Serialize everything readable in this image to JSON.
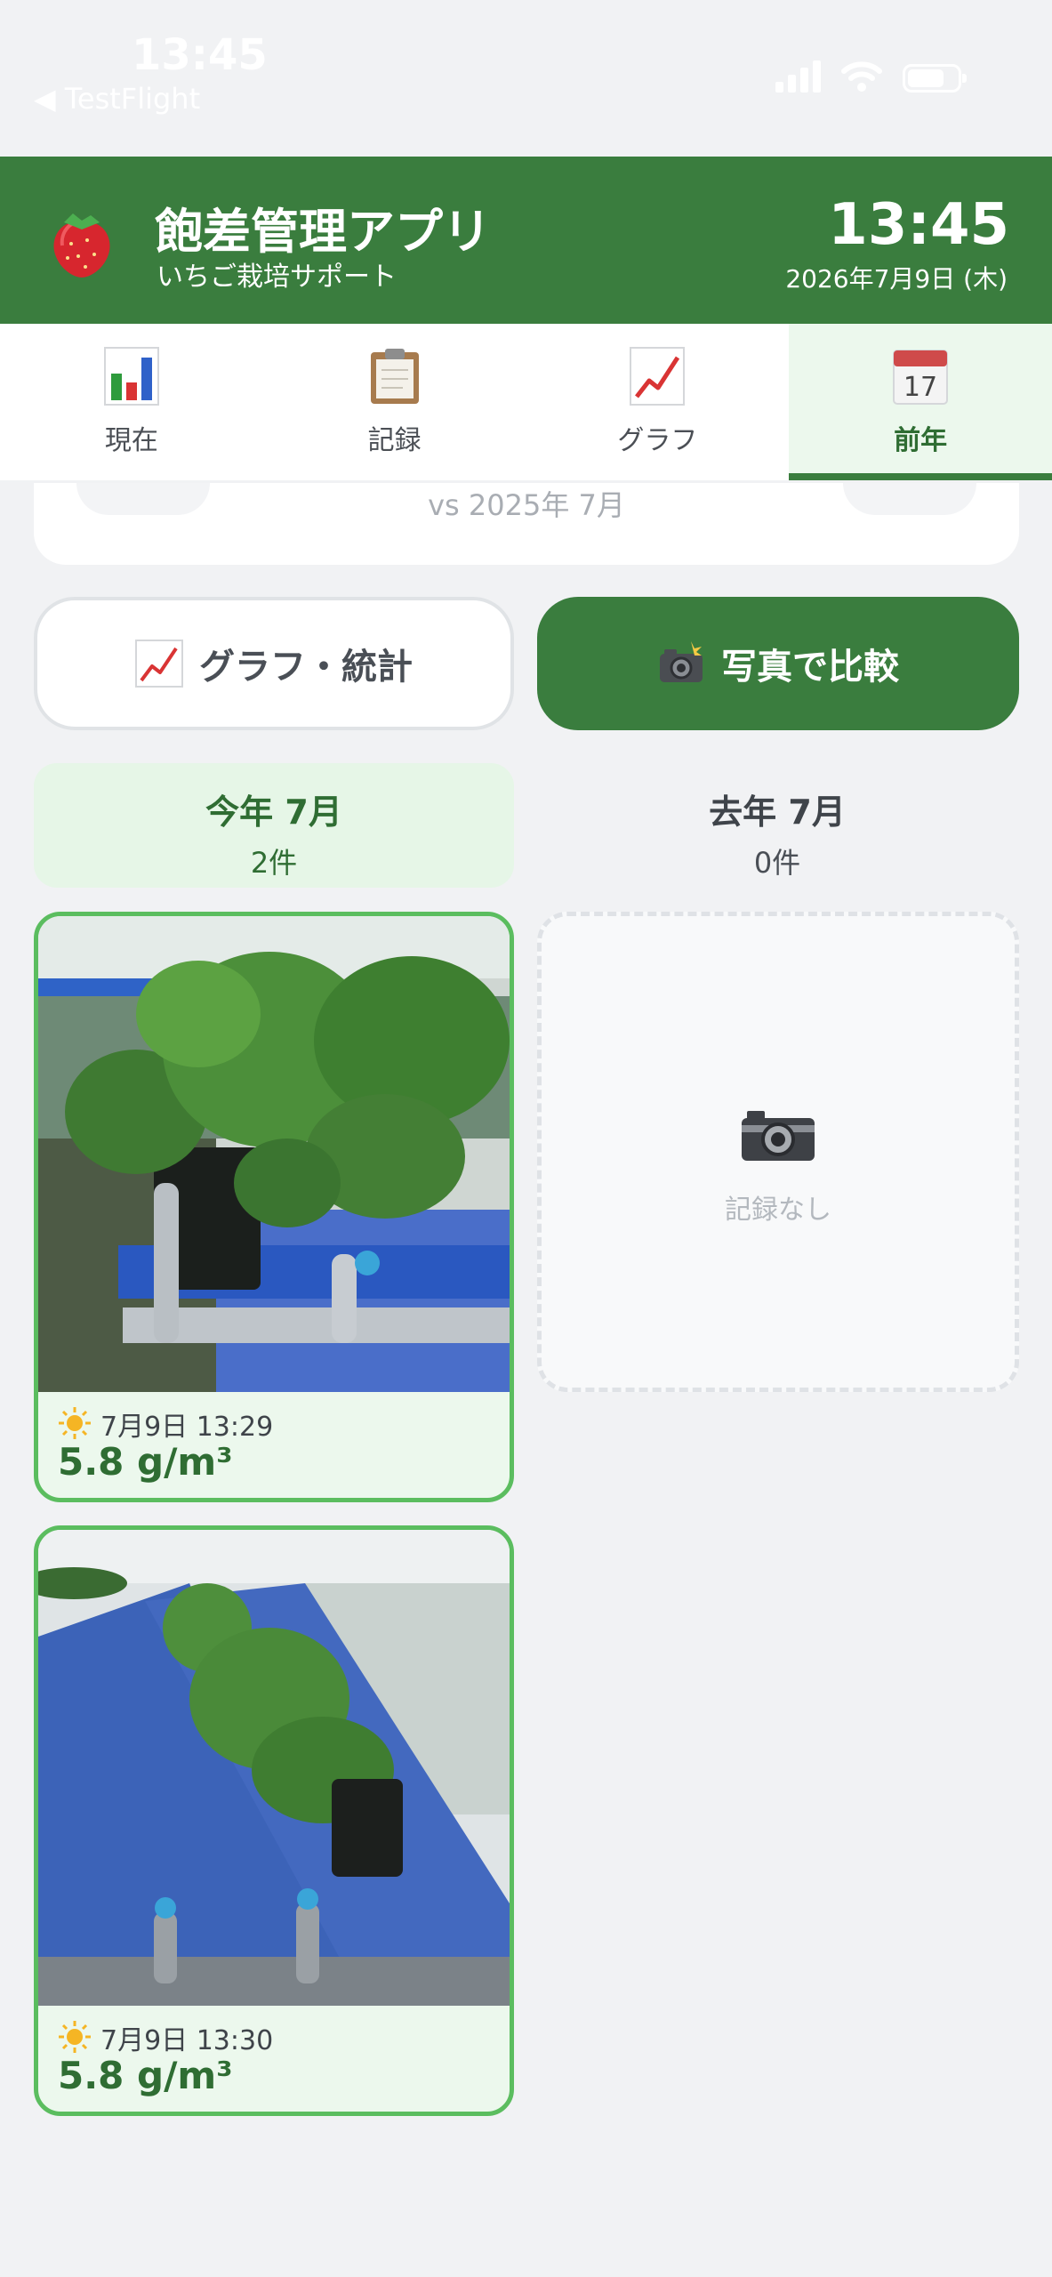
{
  "status_bar": {
    "time": "13:45",
    "back_label": "◀ TestFlight",
    "icons": [
      "signal-icon",
      "wifi-icon",
      "battery-icon"
    ]
  },
  "header": {
    "title": "飽差管理アプリ",
    "subtitle": "いちご栽培サポート",
    "time": "13:45",
    "date": "2026年7月9日 (木)",
    "logo_icon": "strawberry-icon",
    "color": "#3a7d3e"
  },
  "tabs": [
    {
      "label": "現在",
      "icon": "bar-chart-icon",
      "active": false
    },
    {
      "label": "記録",
      "icon": "clipboard-icon",
      "active": false
    },
    {
      "label": "グラフ",
      "icon": "trend-chart-icon",
      "active": false
    },
    {
      "label": "前年",
      "icon": "calendar-icon",
      "active": true
    }
  ],
  "compare": {
    "text": "vs 2025年 7月"
  },
  "buttons": {
    "graph_label": "グラフ・統計",
    "photo_label": "写真で比較"
  },
  "columns": {
    "this_year": {
      "label": "今年 7月",
      "count": "2件"
    },
    "last_year": {
      "label": "去年 7月",
      "count": "0件"
    }
  },
  "photos": [
    {
      "time": "7月9日 13:29",
      "value": "5.8 g/m³",
      "weather_icon": "sun-icon"
    },
    {
      "time": "7月9日 13:30",
      "value": "5.8 g/m³",
      "weather_icon": "sun-icon"
    }
  ],
  "empty": {
    "text": "記録なし",
    "icon": "camera-icon"
  },
  "colors": {
    "primary": "#3a7d3e",
    "accent_border": "#5bbd5f",
    "light_green": "#e6f6e7"
  }
}
